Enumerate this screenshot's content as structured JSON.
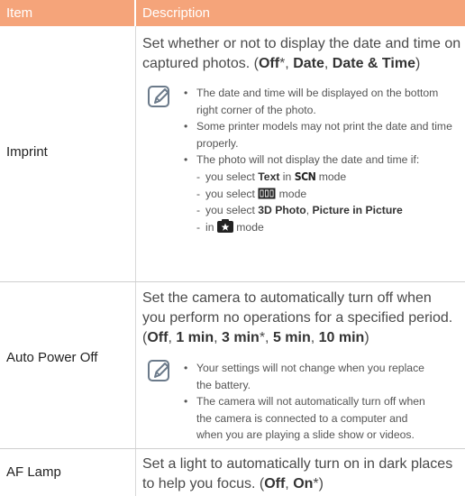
{
  "header": {
    "item": "Item",
    "description": "Description"
  },
  "rows": [
    {
      "item": "Imprint",
      "main_pre": "Set whether or not to display the date and time on captured photos. (",
      "options": [
        "Off",
        "*, ",
        "Date",
        ", ",
        "Date & Time",
        ")"
      ],
      "notes": [
        "The date and time will be displayed on the bottom right corner of the photo.",
        "Some printer models may not print the date and time properly.",
        "The photo will not display the date and time if:"
      ],
      "subs": {
        "s1_pre": "you select ",
        "s1_bold": "Text",
        "s1_mid": " in ",
        "s1_scn": "SCN",
        "s1_post": " mode",
        "s2_pre": "you select ",
        "s2_post": " mode",
        "s3_pre": "you select ",
        "s3_bold1": "3D Photo",
        "s3_mid": ", ",
        "s3_bold2": "Picture in Picture",
        "s3_line2_pre": "in ",
        "s3_line2_post": " mode"
      }
    },
    {
      "item": "Auto Power Off",
      "main_line1": "Set the camera to automatically turn off when",
      "main_line2": "you perform no operations for a specified period.",
      "opt_open": "(",
      "opt1": "Off",
      "sep1": ", ",
      "opt2": "1 min",
      "sep2": ", ",
      "opt3": "3 min",
      "sep3": "*, ",
      "opt4": "5 min",
      "sep4": ", ",
      "opt5": "10 min",
      "opt_close": ")",
      "notes": [
        "Your settings will not change when you replace the battery.",
        "The camera will not automatically turn off when the camera is connected to a computer and when you are playing a slide show or videos."
      ]
    },
    {
      "item": "AF Lamp",
      "main_line1": "Set a light to automatically turn on in dark places",
      "main_line2_pre": "to help you focus. (",
      "opt1": "Off",
      "sep": ", ",
      "opt2": "On",
      "post": "*)"
    }
  ],
  "colors": {
    "header_bg": "#f5a47a",
    "note_icon": "#6b7a8a"
  }
}
